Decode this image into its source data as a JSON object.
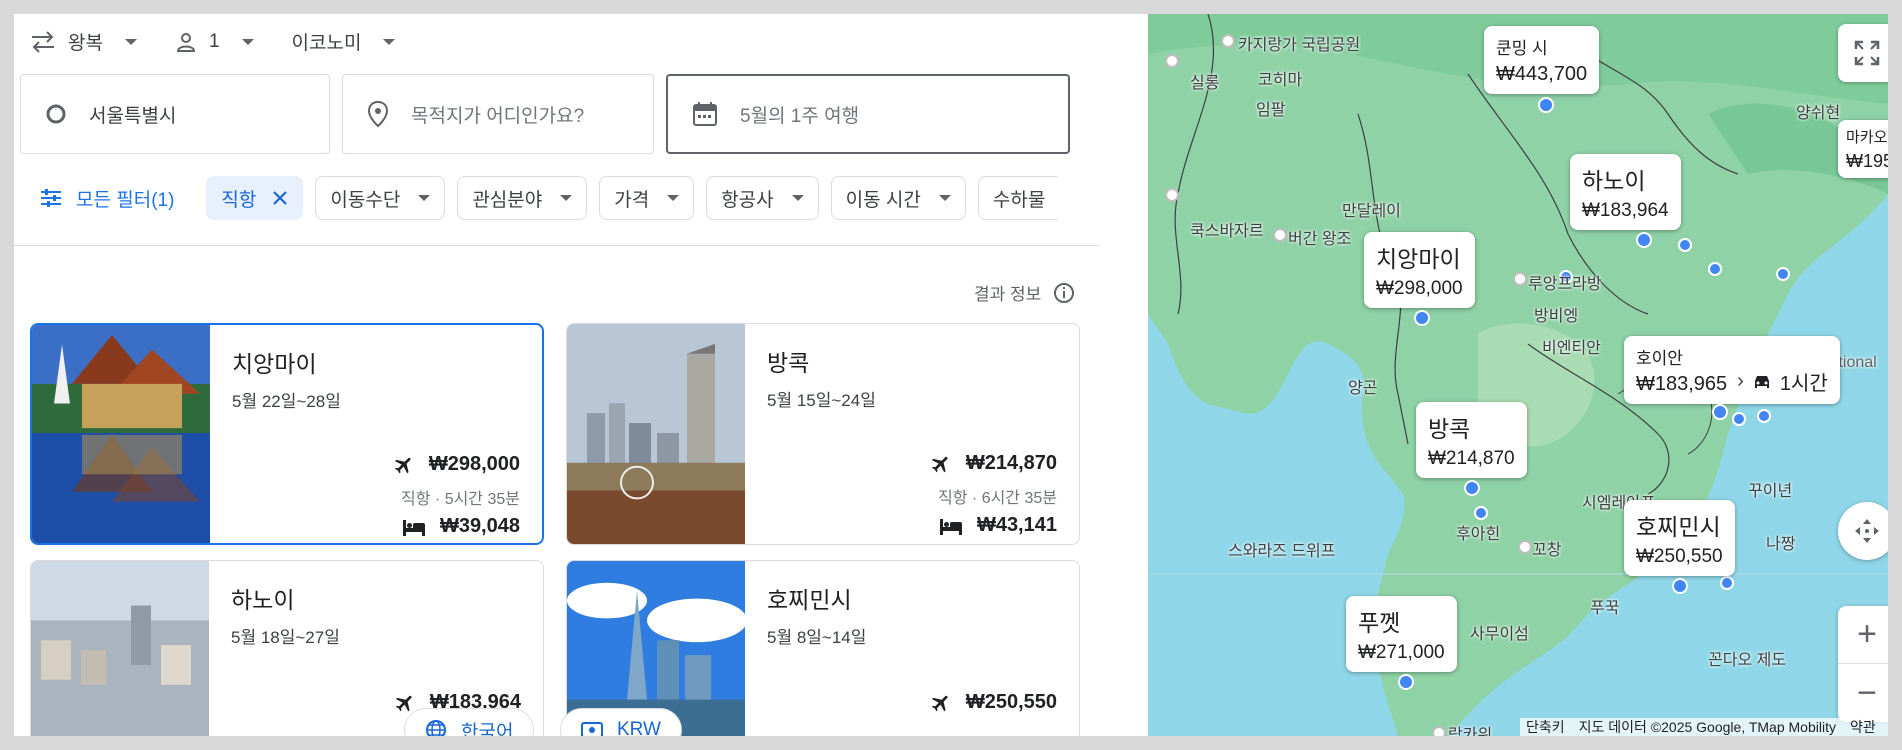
{
  "trip": {
    "type": "왕복",
    "passengers": "1",
    "cabin": "이코노미"
  },
  "search": {
    "origin": "서울특별시",
    "destination_placeholder": "목적지가 어디인가요?",
    "date_text": "5월의 1주 여행"
  },
  "filters": {
    "all_label": "모든 필터(1)",
    "chips": [
      {
        "label": "직항",
        "active": true
      },
      {
        "label": "이동수단"
      },
      {
        "label": "관심분야"
      },
      {
        "label": "가격"
      },
      {
        "label": "항공사"
      },
      {
        "label": "이동 시간"
      },
      {
        "label": "수하물"
      }
    ]
  },
  "results_info": "결과 정보",
  "cards": [
    {
      "city": "치앙마이",
      "dates": "5월 22일~28일",
      "flight_price": "₩298,000",
      "flight_info": "직항 · 5시간 35분",
      "hotel_price": "₩39,048"
    },
    {
      "city": "방콕",
      "dates": "5월 15일~24일",
      "flight_price": "₩214,870",
      "flight_info": "직항 · 6시간 35분",
      "hotel_price": "₩43,141"
    },
    {
      "city": "하노이",
      "dates": "5월 18일~27일",
      "flight_price": "₩183,964"
    },
    {
      "city": "호찌민시",
      "dates": "5월 8일~14일",
      "flight_price": "₩250,550"
    }
  ],
  "footer": {
    "language": "한국어",
    "currency": "KRW"
  },
  "map": {
    "bubbles": [
      {
        "name": "쿤밍 시",
        "price": "₩443,700"
      },
      {
        "name": "하노이",
        "price": "₩183,964"
      },
      {
        "name": "치앙마이",
        "price": "₩298,000"
      },
      {
        "name": "호이안",
        "price": "₩183,965",
        "extra": "1시간"
      },
      {
        "name": "방콕",
        "price": "₩214,870"
      },
      {
        "name": "호찌민시",
        "price": "₩250,550"
      },
      {
        "name": "푸껫",
        "price": "₩271,000"
      },
      {
        "name": "마카오",
        "price": "₩195,"
      }
    ],
    "labels": [
      "카지랑가 국립공원",
      "실롱",
      "코히마",
      "임팔",
      "만달레이",
      "쿡스바자르",
      "버간 왕조",
      "루앙프라방",
      "방비엥",
      "비엔티안",
      "양곤",
      "시엠레아프",
      "후아힌",
      "꼬창",
      "푸꾹",
      "사무이섬",
      "꾸이년",
      "나짱",
      "꼰다오 제도",
      "스와라즈 드위프",
      "랑카위",
      "양쉬현",
      "National"
    ],
    "attribution": {
      "shortcuts": "단축키",
      "data": "지도 데이터 ©2025 Google, TMap Mobility",
      "terms": "약관"
    }
  }
}
